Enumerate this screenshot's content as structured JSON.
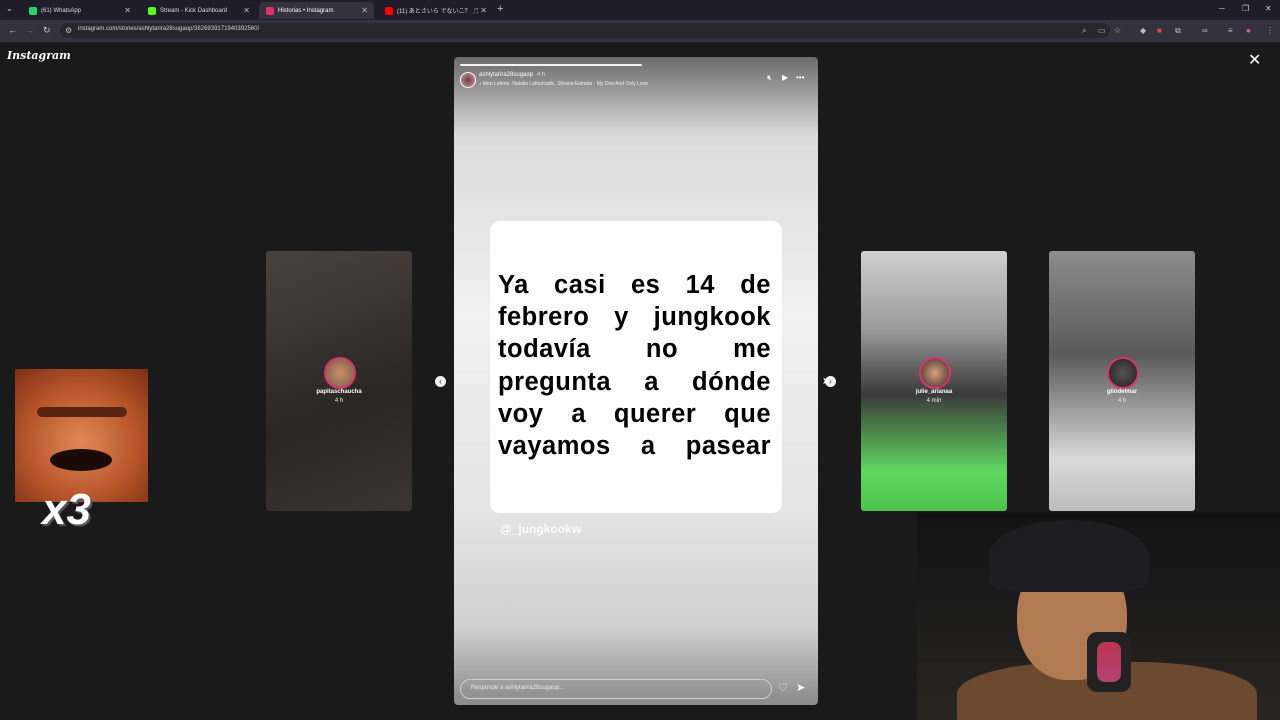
{
  "browser": {
    "tabs": [
      {
        "label": "(61) WhatsApp",
        "color": "#25d366"
      },
      {
        "label": "Stream - Kick Dashboard",
        "color": "#53fc18"
      },
      {
        "label": "Historias • Instagram",
        "color": "#e1306c",
        "active": true
      },
      {
        "label": "(11) あとさいら でないこ？ 🎵",
        "color": "#ff0000"
      }
    ],
    "new_tab": "+",
    "url": "instagram.com/stories/ashlytarira28sugaop/3826939171940392560/"
  },
  "page": {
    "logo": "Instagram",
    "close": "✕"
  },
  "story": {
    "username": "ashlytarira28sugaop",
    "time": "4 h",
    "music": "Mon Laferte, Natalia Lafourcade, Silvana Estrada · My One And Only Love",
    "card_lines": [
      "Ya casi es 14 de",
      "febrero y jungkook",
      "todavía no me",
      "pregunta a dónde",
      "voy a querer que",
      "vayamos a pasear"
    ],
    "mention": "@_jungkookw",
    "reply_placeholder": "Responde a ashlytarira28sugaop..."
  },
  "side_stories": [
    {
      "name": "papitaschaucha",
      "time": "4 h"
    },
    {
      "name": "julie_arianaa",
      "time": "4 min"
    },
    {
      "name": "giiodelmar",
      "time": "4 h"
    }
  ],
  "overlay": {
    "emote_text": "x3"
  }
}
